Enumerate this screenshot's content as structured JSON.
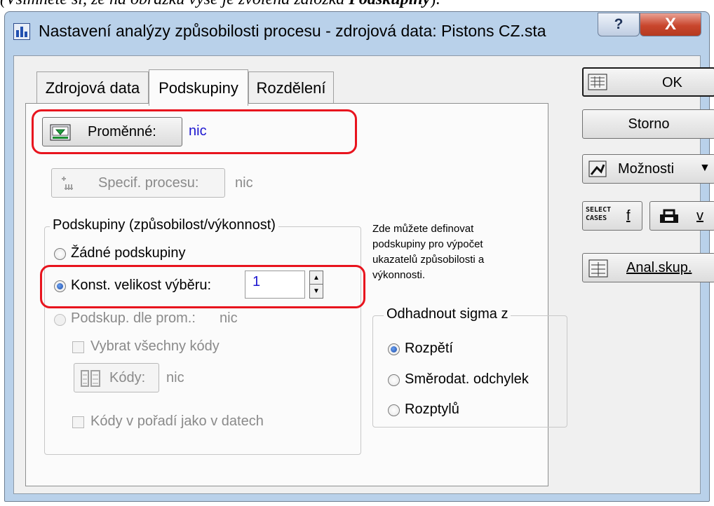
{
  "caption": {
    "prefix": "(Všimněte si, že na obrázku výše je zvolena záložka ",
    "bold": "Podskupiny",
    "suffix": ")."
  },
  "window": {
    "title": "Nastavení analýzy způsobilosti procesu - zdrojová data: Pistons CZ.sta",
    "help": "?",
    "close": "X"
  },
  "tabs": [
    "Zdrojová data",
    "Podskupiny",
    "Rozdělení"
  ],
  "variables": {
    "button": "Proměnné:",
    "value": "nic"
  },
  "process": {
    "button": "Specif. procesu:",
    "value": "nic"
  },
  "subgroups": {
    "legend": "Podskupiny (způsobilost/výkonnost)",
    "options": [
      "Žádné podskupiny",
      "Konst. velikost výběru:",
      "Podskup. dle prom.:"
    ],
    "selected": 1,
    "size_value": "1",
    "by_var_value": "nic",
    "select_all": "Vybrat všechny kódy",
    "codes_button": "Kódy:",
    "codes_value": "nic",
    "codes_order": "Kódy v pořadí jako v datech"
  },
  "hint": [
    "Zde můžete definovat",
    "podskupiny pro výpočet",
    "ukazatelů způsobilosti a",
    "výkonnosti."
  ],
  "sigma": {
    "legend": "Odhadnout sigma z",
    "options": [
      "Rozpětí",
      "Směrodat. odchylek",
      "Rozptylů"
    ],
    "selected": 0
  },
  "buttons": {
    "ok": "OK",
    "cancel": "Storno",
    "options": "Možnosti",
    "select_f": "f",
    "weight_v": "v",
    "analysis": "Anal.skup.",
    "select_icon_text": "SELECT CASES"
  }
}
